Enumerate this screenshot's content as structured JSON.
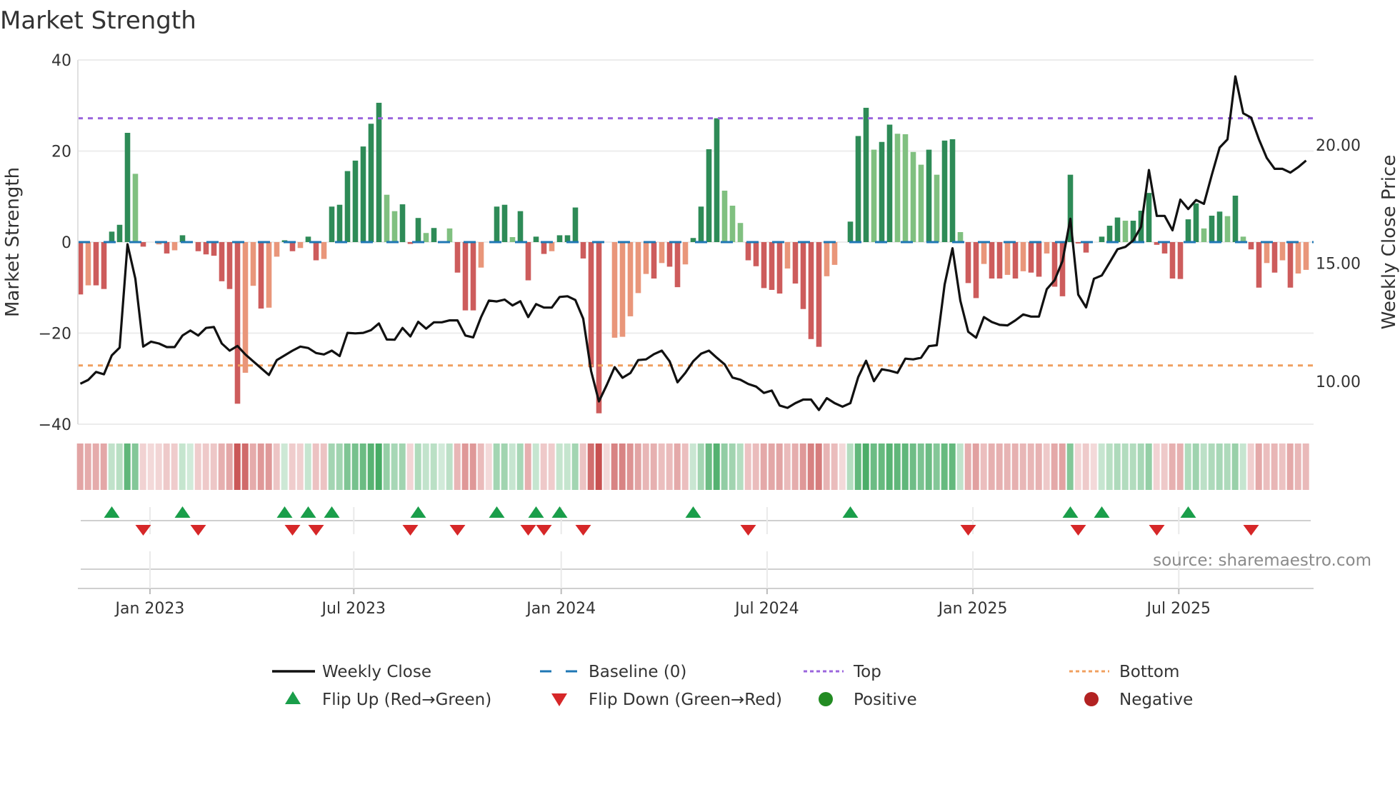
{
  "chart_data": {
    "type": "bar",
    "title": "Market Strength",
    "ylabel": "Market Strength",
    "y2label": "Weekly Close Price",
    "ylim": [
      -40,
      40
    ],
    "y2lim": [
      8.19,
      23.56
    ],
    "yticks": [
      40,
      20,
      0,
      -20,
      -40
    ],
    "ytick_labels": [
      "40",
      "20",
      "0",
      "−20",
      "−40"
    ],
    "y2ticks": [
      20,
      15,
      10
    ],
    "y2tick_labels": [
      "20.00",
      "15.00",
      "10.00"
    ],
    "x_unit": "week index",
    "xticks": [
      {
        "label": "Jan 2023",
        "x": 8.86
      },
      {
        "label": "Jul 2023",
        "x": 34.8
      },
      {
        "label": "Jan 2024",
        "x": 61.2
      },
      {
        "label": "Jul 2024",
        "x": 87.4
      },
      {
        "label": "Jan 2025",
        "x": 113.6
      },
      {
        "label": "Jul 2025",
        "x": 139.8
      }
    ],
    "top_level": 27.2,
    "bottom_level": -27.1,
    "grid": true,
    "legend_position": "bottom",
    "source": "source: sharemaestro.com",
    "strength": [
      -11.5,
      -9.5,
      -9.5,
      -10.3,
      2.3,
      3.8,
      24,
      15,
      -1,
      0,
      -0.5,
      -2.5,
      -1.8,
      1.5,
      0,
      -2,
      -2.7,
      -3,
      -8.6,
      -10.3,
      -35.5,
      -28.7,
      -9.6,
      -14.6,
      -14.4,
      -3.2,
      0.4,
      -2,
      -1.3,
      1.2,
      -4,
      -3.7,
      7.8,
      8.2,
      15.6,
      17.9,
      21,
      26,
      30.6,
      10.4,
      6.8,
      8.3,
      -0.4,
      5.3,
      2,
      3.1,
      0,
      3,
      -6.7,
      -15,
      -15,
      -5.6,
      0,
      7.8,
      8.2,
      1.1,
      6.8,
      -8.4,
      1.2,
      -2.6,
      -2,
      1.5,
      1.5,
      7.6,
      -3.6,
      -27.5,
      -37.6,
      0,
      -21,
      -20.8,
      -16.3,
      -11.2,
      -7,
      -8,
      -4.6,
      -5.4,
      -9.9,
      -4.9,
      0.9,
      7.8,
      20.4,
      27.2,
      11.3,
      8,
      4.2,
      -4,
      -5.3,
      -10.1,
      -10.5,
      -11.3,
      -5.8,
      -9.1,
      -14.7,
      -21.3,
      -23,
      -7.5,
      -5,
      0,
      4.5,
      23.3,
      29.5,
      20.3,
      22,
      25.8,
      23.8,
      23.7,
      19.8,
      17,
      20.3,
      14.8,
      22.3,
      22.6,
      2.2,
      -9,
      -12.3,
      -4.8,
      -8,
      -8,
      -7.2,
      -8,
      -6.4,
      -6.7,
      -7.6,
      -2.5,
      -9.8,
      -11.9,
      14.8,
      -0.3,
      -2.3,
      0,
      1.2,
      3.6,
      5.4,
      4.7,
      4.7,
      6.9,
      10.8,
      -0.6,
      -2.5,
      -8,
      -8.1,
      5,
      8.5,
      3,
      5.8,
      6.7,
      5.7,
      10.2,
      1.2,
      -1.6,
      -10,
      -4.6,
      -6.7,
      -4,
      -10,
      -6.9,
      -6.1
    ],
    "weekly_close": [
      9.9,
      10.06,
      10.4,
      10.3,
      11.1,
      11.43,
      15.8,
      14.34,
      11.47,
      11.68,
      11.6,
      11.45,
      11.45,
      11.94,
      12.15,
      11.94,
      12.26,
      12.3,
      11.6,
      11.3,
      11.5,
      11.14,
      10.85,
      10.56,
      10.27,
      10.9,
      11.1,
      11.3,
      11.47,
      11.41,
      11.2,
      11.14,
      11.3,
      11.07,
      12.05,
      12.03,
      12.05,
      12.17,
      12.45,
      11.77,
      11.76,
      12.26,
      11.9,
      12.52,
      12.23,
      12.5,
      12.5,
      12.58,
      12.58,
      11.94,
      11.86,
      12.72,
      13.42,
      13.38,
      13.46,
      13.21,
      13.39,
      12.72,
      13.27,
      13.12,
      13.12,
      13.57,
      13.6,
      13.44,
      12.65,
      10.44,
      9.15,
      9.85,
      10.6,
      10.15,
      10.35,
      10.9,
      10.93,
      11.15,
      11.3,
      10.85,
      9.96,
      10.36,
      10.85,
      11.17,
      11.3,
      11.0,
      10.72,
      10.16,
      10.07,
      9.89,
      9.78,
      9.51,
      9.61,
      8.98,
      8.88,
      9.08,
      9.23,
      9.23,
      8.79,
      9.29,
      9.08,
      8.93,
      9.08,
      10.18,
      10.87,
      10.01,
      10.51,
      10.45,
      10.36,
      10.96,
      10.93,
      11.0,
      11.49,
      11.53,
      14.1,
      15.63,
      13.41,
      12.1,
      11.85,
      12.72,
      12.51,
      12.39,
      12.37,
      12.58,
      12.83,
      12.74,
      12.74,
      13.9,
      14.28,
      15.09,
      16.88,
      13.67,
      13.13,
      14.34,
      14.48,
      15.03,
      15.59,
      15.69,
      15.96,
      16.54,
      18.94,
      17.0,
      17.0,
      16.39,
      17.69,
      17.29,
      17.67,
      17.51,
      18.73,
      19.89,
      20.24,
      22.9,
      21.34,
      21.16,
      20.24,
      19.45,
      18.99,
      18.99,
      18.83,
      19.06,
      19.34
    ],
    "legend": [
      {
        "label": "Weekly Close",
        "icon": "line"
      },
      {
        "label": "Baseline (0)",
        "icon": "dashed-line"
      },
      {
        "label": "Top",
        "icon": "dotted-line"
      },
      {
        "label": "Bottom",
        "icon": "dotted-line"
      },
      {
        "label": "Flip Up (Red→Green)",
        "icon": "triangle-up"
      },
      {
        "label": "Flip Down (Green→Red)",
        "icon": "triangle-down"
      },
      {
        "label": "Positive",
        "icon": "circle"
      },
      {
        "label": "Negative",
        "icon": "circle"
      }
    ],
    "colors": {
      "pos_strong": "#2e8b57",
      "pos_weak": "#80c080",
      "neg_strong": "#cd5c5c",
      "neg_weak": "#e9967a",
      "line": "#111111",
      "baseline": "#1f77b4",
      "top": "#9b66dd",
      "bottom": "#f0a060",
      "flip_up": "#1a9e4a",
      "flip_down": "#d62728",
      "positive": "#228b22",
      "negative": "#b22222"
    }
  }
}
